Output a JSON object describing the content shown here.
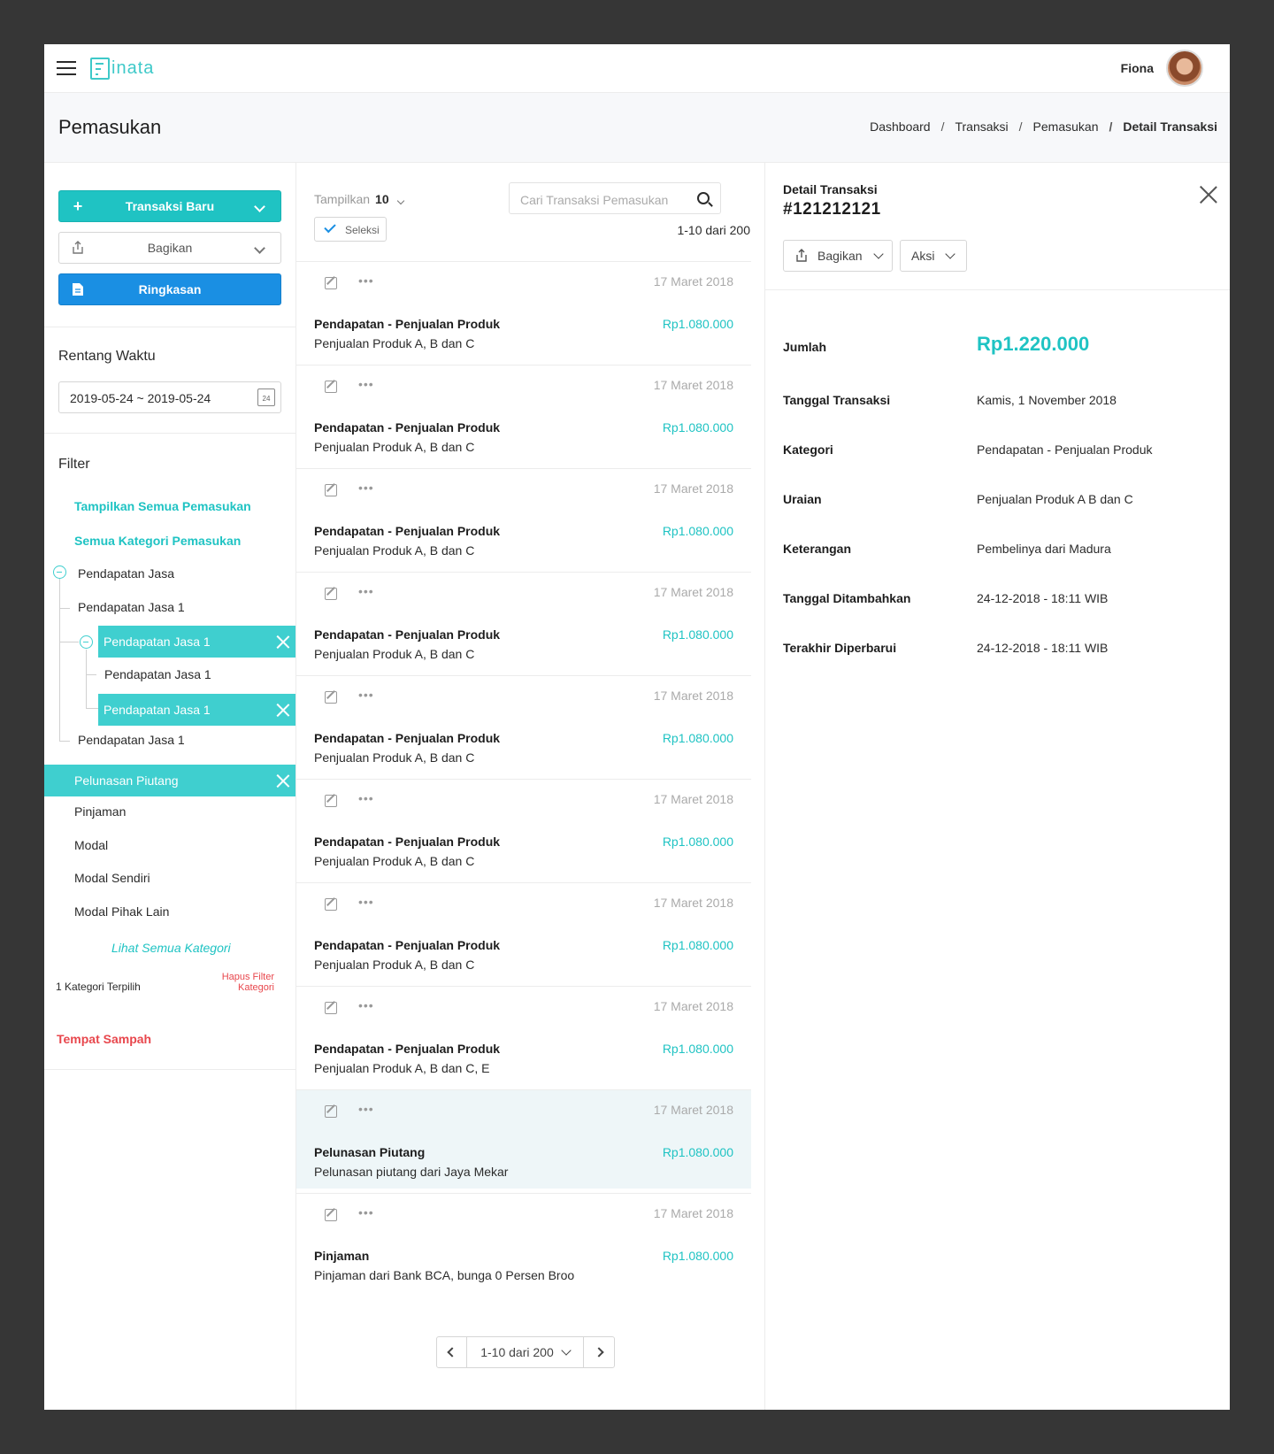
{
  "header": {
    "logo": "inata",
    "user_name": "Fiona"
  },
  "page": {
    "title": "Pemasukan",
    "breadcrumb": [
      "Dashboard",
      "Transaksi",
      "Pemasukan",
      "Detail Transaksi"
    ]
  },
  "sidebar": {
    "new_btn": "Transaksi Baru",
    "share_btn": "Bagikan",
    "summary_btn": "Ringkasan",
    "range_title": "Rentang Waktu",
    "date_range": "2019-05-24 ~ 2019-05-24",
    "cal_day": "24",
    "filter_title": "Filter",
    "show_all": "Tampilkan Semua Pemasukan",
    "all_categories": "Semua Kategori Pemasukan",
    "tree": {
      "jasa": "Pendapatan Jasa",
      "jasa1a": "Pendapatan Jasa 1",
      "jasa1b": "Pendapatan Jasa 1",
      "jasa1c": "Pendapatan Jasa 1",
      "jasa1d": "Pendapatan Jasa 1",
      "jasa1e": "Pendapatan Jasa 1"
    },
    "pelunasan": "Pelunasan Piutang",
    "pinjaman": "Pinjaman",
    "modal": "Modal",
    "modal_sendiri": "Modal Sendiri",
    "modal_pihak": "Modal Pihak Lain",
    "see_all": "Lihat Semua Kategori",
    "selected_count": "1 Kategori Terpilih",
    "clear_filter_1": "Hapus Filter",
    "clear_filter_2": "Kategori",
    "trash": "Tempat Sampah",
    "colors": {
      "accent": "#1fc3c3",
      "selected": "#3fcfcf",
      "blue": "#1a8fe3",
      "danger": "#e8474d"
    }
  },
  "list": {
    "show_label": "Tampilkan",
    "show_value": "10",
    "search_placeholder": "Cari Transaksi Pemasukan",
    "select_btn": "Seleksi",
    "count": "1-10 dari 200",
    "rows": [
      {
        "date": "17 Maret 2018",
        "title": "Pendapatan - Penjualan Produk",
        "amount": "Rp1.080.000",
        "desc": "Penjualan Produk A, B dan C"
      },
      {
        "date": "17 Maret 2018",
        "title": "Pendapatan - Penjualan Produk",
        "amount": "Rp1.080.000",
        "desc": "Penjualan Produk A, B dan C"
      },
      {
        "date": "17 Maret 2018",
        "title": "Pendapatan - Penjualan Produk",
        "amount": "Rp1.080.000",
        "desc": "Penjualan Produk A, B dan C"
      },
      {
        "date": "17 Maret 2018",
        "title": "Pendapatan - Penjualan Produk",
        "amount": "Rp1.080.000",
        "desc": "Penjualan Produk A, B dan C"
      },
      {
        "date": "17 Maret 2018",
        "title": "Pendapatan - Penjualan Produk",
        "amount": "Rp1.080.000",
        "desc": "Penjualan Produk A, B dan C"
      },
      {
        "date": "17 Maret 2018",
        "title": "Pendapatan - Penjualan Produk",
        "amount": "Rp1.080.000",
        "desc": "Penjualan Produk A, B dan C"
      },
      {
        "date": "17 Maret 2018",
        "title": "Pendapatan - Penjualan Produk",
        "amount": "Rp1.080.000",
        "desc": "Penjualan Produk A, B dan C"
      },
      {
        "date": "17 Maret 2018",
        "title": "Pendapatan - Penjualan Produk",
        "amount": "Rp1.080.000",
        "desc": "Penjualan Produk A, B dan C, E"
      },
      {
        "date": "17 Maret 2018",
        "title": "Pelunasan Piutang",
        "amount": "Rp1.080.000",
        "desc": "Pelunasan piutang dari Jaya Mekar",
        "highlight": true
      },
      {
        "date": "17 Maret 2018",
        "title": "Pinjaman",
        "amount": "Rp1.080.000",
        "desc": "Pinjaman dari Bank BCA, bunga 0 Persen Broo"
      }
    ],
    "more_glyph": "•••",
    "pager_label": "1-10 dari 200"
  },
  "detail": {
    "heading": "Detail Transaksi",
    "id": "#121212121",
    "share_btn": "Bagikan",
    "action_btn": "Aksi",
    "fields": [
      {
        "label": "Jumlah",
        "value": "Rp1.220.000"
      },
      {
        "label": "Tanggal Transaksi",
        "value": "Kamis, 1 November 2018"
      },
      {
        "label": "Kategori",
        "value": "Pendapatan - Penjualan Produk"
      },
      {
        "label": "Uraian",
        "value": "Penjualan Produk A B dan C"
      },
      {
        "label": "Keterangan",
        "value": "Pembelinya dari Madura"
      },
      {
        "label": "Tanggal Ditambahkan",
        "value": "24-12-2018 - 18:11 WIB"
      },
      {
        "label": "Terakhir Diperbarui",
        "value": "24-12-2018 - 18:11 WIB"
      }
    ]
  }
}
